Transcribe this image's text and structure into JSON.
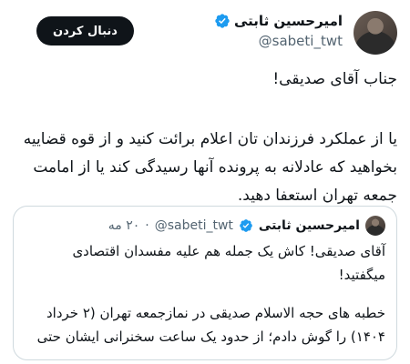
{
  "tweet": {
    "author": {
      "name": "امیرحسین ثابتی",
      "handle": "@sabeti_twt"
    },
    "follow_label": "دنبال کردن",
    "text_line1": "جناب آقای صدیقی!",
    "text_para2": "یا از عملکرد فرزندان تان اعلام برائت کنید و از قوه قضاییه بخواهید که عادلانه به پرونده آنها رسیدگی کند یا از امامت جمعه تهران استعفا دهید."
  },
  "quote": {
    "author": {
      "name": "امیرحسین ثابتی",
      "handle": "@sabeti_twt"
    },
    "separator": "·",
    "time": "۲۰ مه",
    "text_line1": "آقای صدیقی! کاش یک جمله هم علیه مفسدان اقتصادی میگفتید!",
    "text_para2": "خطبه های حجه الاسلام صدیقی در نمازجمعه تهران (۲ خرداد ۱۴۰۴) را گوش دادم؛ از حدود یک ساعت سخنرانی ایشان حتی ..."
  },
  "colors": {
    "text": "#0f1419",
    "secondary": "#536471",
    "verified": "#1d9bf0",
    "follow_bg": "#0f1419",
    "border": "#cfd9de"
  },
  "icons": {
    "verified": "verified-badge-icon"
  }
}
